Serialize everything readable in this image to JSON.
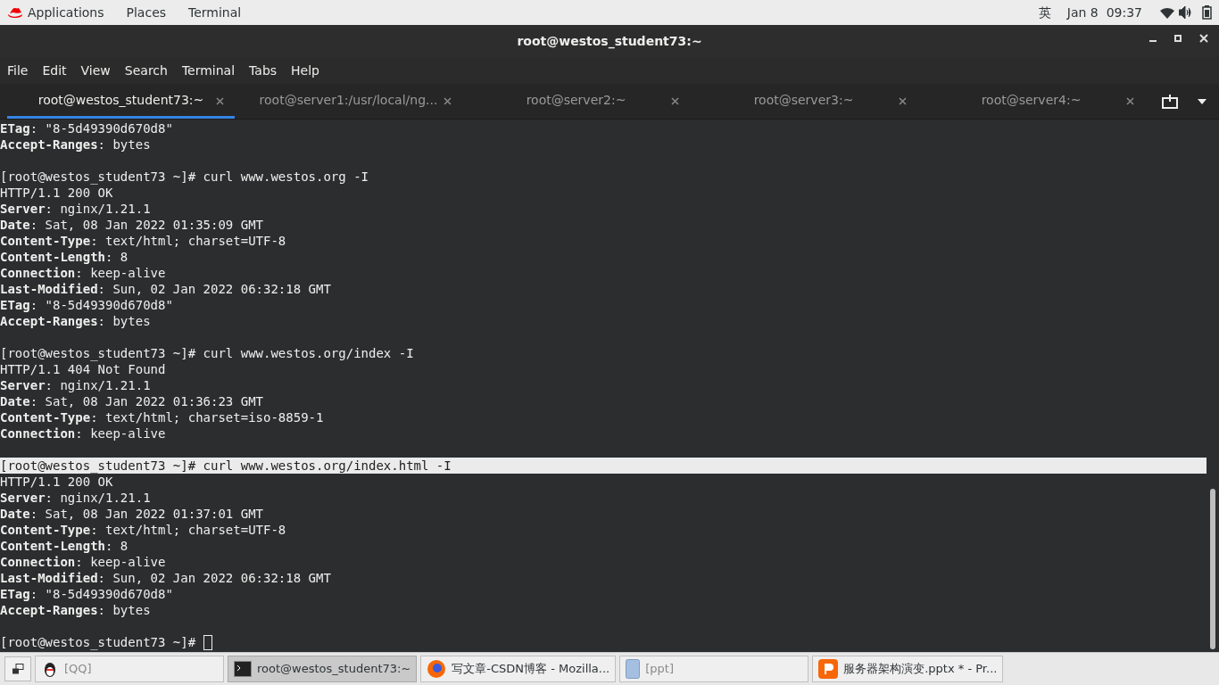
{
  "top_bar": {
    "menus": [
      "Applications",
      "Places",
      "Terminal"
    ],
    "input_method": "英",
    "clock": "Jan 8  09:37"
  },
  "window": {
    "title": "root@westos_student73:~"
  },
  "menu_bar": [
    "File",
    "Edit",
    "View",
    "Search",
    "Terminal",
    "Tabs",
    "Help"
  ],
  "tabs": [
    {
      "label": "root@westos_student73:~",
      "selected": true
    },
    {
      "label": "root@server1:/usr/local/ng...",
      "selected": false
    },
    {
      "label": "root@server2:~",
      "selected": false
    },
    {
      "label": "root@server3:~",
      "selected": false
    },
    {
      "label": "root@server4:~",
      "selected": false
    }
  ],
  "terminal": {
    "lines": [
      {
        "kind": "output",
        "text": "**ETag**: \"8-5d49390d670d8\""
      },
      {
        "kind": "output",
        "text": "**Accept-Ranges**: bytes"
      },
      {
        "kind": "blank"
      },
      {
        "kind": "prompt",
        "text": "[root@westos_student73 ~]# curl www.westos.org -I",
        "highlighted": false
      },
      {
        "kind": "output",
        "text": "HTTP/1.1 200 OK"
      },
      {
        "kind": "output",
        "text": "**Server**: nginx/1.21.1"
      },
      {
        "kind": "output",
        "text": "**Date**: Sat, 08 Jan 2022 01:35:09 GMT"
      },
      {
        "kind": "output",
        "text": "**Content-Type**: text/html; charset=UTF-8"
      },
      {
        "kind": "output",
        "text": "**Content-Length**: 8"
      },
      {
        "kind": "output",
        "text": "**Connection**: keep-alive"
      },
      {
        "kind": "output",
        "text": "**Last-Modified**: Sun, 02 Jan 2022 06:32:18 GMT"
      },
      {
        "kind": "output",
        "text": "**ETag**: \"8-5d49390d670d8\""
      },
      {
        "kind": "output",
        "text": "**Accept-Ranges**: bytes"
      },
      {
        "kind": "blank"
      },
      {
        "kind": "prompt",
        "text": "[root@westos_student73 ~]# curl www.westos.org/index -I",
        "highlighted": false
      },
      {
        "kind": "output",
        "text": "HTTP/1.1 404 Not Found"
      },
      {
        "kind": "output",
        "text": "**Server**: nginx/1.21.1"
      },
      {
        "kind": "output",
        "text": "**Date**: Sat, 08 Jan 2022 01:36:23 GMT"
      },
      {
        "kind": "output",
        "text": "**Content-Type**: text/html; charset=iso-8859-1"
      },
      {
        "kind": "output",
        "text": "**Connection**: keep-alive"
      },
      {
        "kind": "blank"
      },
      {
        "kind": "prompt",
        "text": "[root@westos_student73 ~]# curl www.westos.org/index.html -I",
        "highlighted": true
      },
      {
        "kind": "output",
        "text": "HTTP/1.1 200 OK"
      },
      {
        "kind": "output",
        "text": "**Server**: nginx/1.21.1"
      },
      {
        "kind": "output",
        "text": "**Date**: Sat, 08 Jan 2022 01:37:01 GMT"
      },
      {
        "kind": "output",
        "text": "**Content-Type**: text/html; charset=UTF-8"
      },
      {
        "kind": "output",
        "text": "**Content-Length**: 8"
      },
      {
        "kind": "output",
        "text": "**Connection**: keep-alive"
      },
      {
        "kind": "output",
        "text": "**Last-Modified**: Sun, 02 Jan 2022 06:32:18 GMT"
      },
      {
        "kind": "output",
        "text": "**ETag**: \"8-5d49390d670d8\""
      },
      {
        "kind": "output",
        "text": "**Accept-Ranges**: bytes"
      },
      {
        "kind": "blank"
      },
      {
        "kind": "prompt",
        "text": "[root@westos_student73 ~]# ",
        "highlighted": false,
        "cursor": true
      }
    ]
  },
  "taskbar": [
    {
      "label": "[QQ]",
      "kind": "penguin",
      "selected": false,
      "dim": true
    },
    {
      "label": "root@westos_student73:~",
      "kind": "terminal",
      "selected": true,
      "dim": false
    },
    {
      "label": "写文章-CSDN博客 - Mozilla...",
      "kind": "browser",
      "selected": false,
      "dim": false
    },
    {
      "label": "[ppt]",
      "kind": "file",
      "selected": false,
      "dim": true
    },
    {
      "label": "服务器架构演变.pptx * - Pr...",
      "kind": "slides",
      "selected": false,
      "dim": false
    }
  ]
}
